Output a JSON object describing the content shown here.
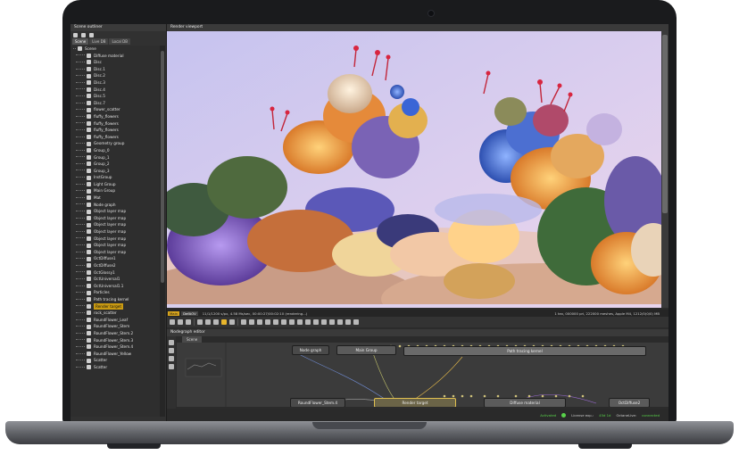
{
  "scene_outliner": {
    "title": "Scene outliner",
    "tabs": [
      "Scene",
      "Live DB",
      "Local DB"
    ],
    "items": [
      {
        "label": "Scene",
        "root": true
      },
      {
        "label": "Diffuse material"
      },
      {
        "label": "Disc"
      },
      {
        "label": "Disc.1"
      },
      {
        "label": "Disc.2"
      },
      {
        "label": "Disc.3"
      },
      {
        "label": "Disc.4"
      },
      {
        "label": "Disc.5"
      },
      {
        "label": "Disc.7"
      },
      {
        "label": "flower_scatter"
      },
      {
        "label": "fluffy_flowers"
      },
      {
        "label": "fluffy_flowers"
      },
      {
        "label": "fluffy_flowers"
      },
      {
        "label": "fluffy_flowers"
      },
      {
        "label": "Geometry group"
      },
      {
        "label": "Group_0"
      },
      {
        "label": "Group_1"
      },
      {
        "label": "Group_2"
      },
      {
        "label": "Group_3"
      },
      {
        "label": "InstGroup"
      },
      {
        "label": "Light Group"
      },
      {
        "label": "Main Group"
      },
      {
        "label": "Mat"
      },
      {
        "label": "Node graph"
      },
      {
        "label": "Object layer map"
      },
      {
        "label": "Object layer map"
      },
      {
        "label": "Object layer map"
      },
      {
        "label": "Object layer map"
      },
      {
        "label": "Object layer map"
      },
      {
        "label": "Object layer map"
      },
      {
        "label": "Object layer map"
      },
      {
        "label": "OctDiffuse1"
      },
      {
        "label": "OctDiffuse2"
      },
      {
        "label": "OctGlossy1"
      },
      {
        "label": "OctUniversal1"
      },
      {
        "label": "OctUniversal1.1"
      },
      {
        "label": "Particles"
      },
      {
        "label": "Path tracing kernel"
      },
      {
        "label": "Render target",
        "selected": true
      },
      {
        "label": "rock_scatter"
      },
      {
        "label": "RoundFlower_Leaf"
      },
      {
        "label": "RoundFlower_Stem"
      },
      {
        "label": "RoundFlower_Stem.2"
      },
      {
        "label": "RoundFlower_Stem.3"
      },
      {
        "label": "RoundFlower_Stem.4"
      },
      {
        "label": "RoundFlower_Yellow"
      },
      {
        "label": "Scatter"
      },
      {
        "label": "Scatter"
      }
    ]
  },
  "render_viewport": {
    "title": "Render viewport",
    "status_tags": [
      "Main",
      "DefAOV"
    ],
    "status_text": "11/1/1200 s/px, 4.58 Ms/sec, 00:00:27/00:02:10 (rendering...)",
    "status_right": "1 tex, 000000 pri, 222000 meshes, Apple M4, 1212/0(0/0) MB"
  },
  "nodegraph": {
    "title": "Nodegraph editor",
    "tab": "Scene",
    "nodes": {
      "node_graph": "Node graph",
      "main_group": "Main Group",
      "path_tracing_kernel": "Path tracing kernel",
      "round_flower_stem": "RoundFlower_Stem.4",
      "render_target": "Render target",
      "diffuse_material": "Diffuse material",
      "oct_diffuse": "OctDiffuse2"
    }
  },
  "footer": {
    "activated": "Activated",
    "license_exp": "License exp.:",
    "license_days": "45d 1d",
    "octanelive": "OctaneLive:",
    "connected": "connected"
  },
  "colors": {
    "accent": "#d8a51d",
    "connected": "#58d24a",
    "panel_bg": "#2b2b2b"
  }
}
